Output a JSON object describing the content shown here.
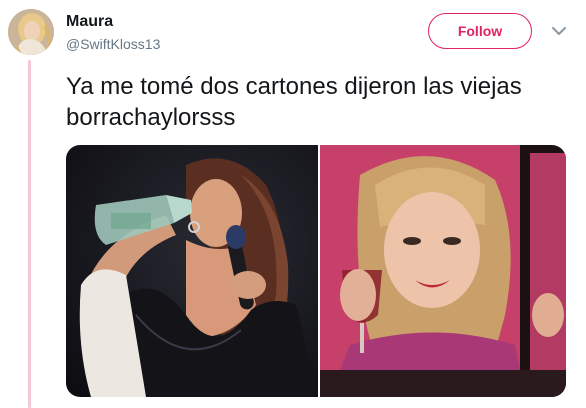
{
  "tweet": {
    "author": {
      "display_name": "Maura",
      "handle": "@SwiftKloss13"
    },
    "follow_label": "Follow",
    "text": "Ya me tomé dos cartones dijeron las viejas borrachaylorsss",
    "media_count": 2
  },
  "colors": {
    "accent": "#e0245e",
    "thread_line": "#f5c6d6",
    "text": "#14171a",
    "muted": "#657786"
  },
  "icons": {
    "menu": "chevron-down-icon"
  }
}
